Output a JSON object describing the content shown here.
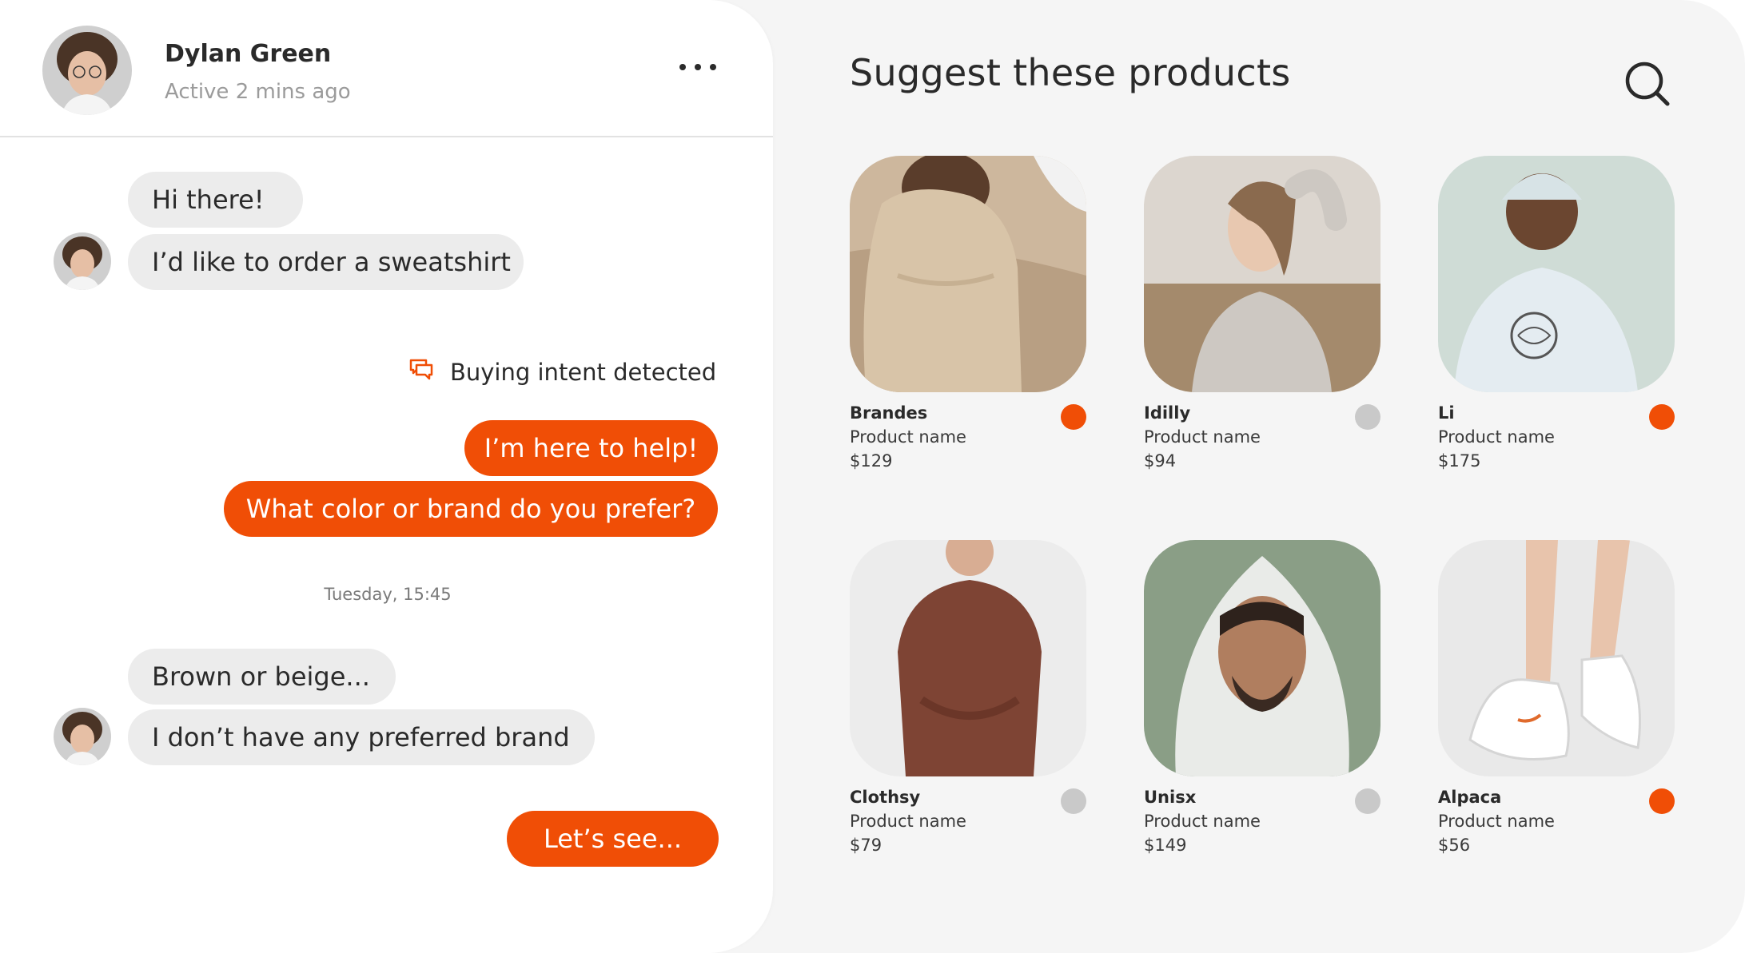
{
  "header": {
    "user_name": "Dylan Green",
    "status": "Active 2 mins ago"
  },
  "messages": [
    {
      "from": "customer",
      "text": "Hi there!"
    },
    {
      "from": "customer",
      "text": "I’d like to order a sweatshirt"
    },
    {
      "from": "agent",
      "text": "I’m here to help!"
    },
    {
      "from": "agent",
      "text": "What color or brand do you prefer?"
    },
    {
      "from": "customer",
      "text": "Brown or beige..."
    },
    {
      "from": "customer",
      "text": "I don’t have any preferred brand"
    },
    {
      "from": "agent",
      "text": "Let’s see..."
    }
  ],
  "intent": {
    "icon": "chat-bubbles-icon",
    "label": "Buying intent detected"
  },
  "timestamp": "Tuesday, 15:45",
  "products_panel": {
    "title": "Suggest these products",
    "search_icon": "search-icon"
  },
  "products": [
    {
      "brand": "Brandes",
      "name": "Product name",
      "price": "$129",
      "selected": true
    },
    {
      "brand": "Idilly",
      "name": "Product name",
      "price": "$94",
      "selected": false
    },
    {
      "brand": "Li",
      "name": "Product name",
      "price": "$175",
      "selected": true
    },
    {
      "brand": "Clothsy",
      "name": "Product name",
      "price": "$79",
      "selected": false
    },
    {
      "brand": "Unisx",
      "name": "Product name",
      "price": "$149",
      "selected": false
    },
    {
      "brand": "Alpaca",
      "name": "Product name",
      "price": "$56",
      "selected": true
    }
  ],
  "colors": {
    "accent": "#f04e06",
    "incoming_bubble": "#ececec",
    "panel_bg": "#f5f5f5",
    "unselected_dot": "#c9c9c9"
  }
}
